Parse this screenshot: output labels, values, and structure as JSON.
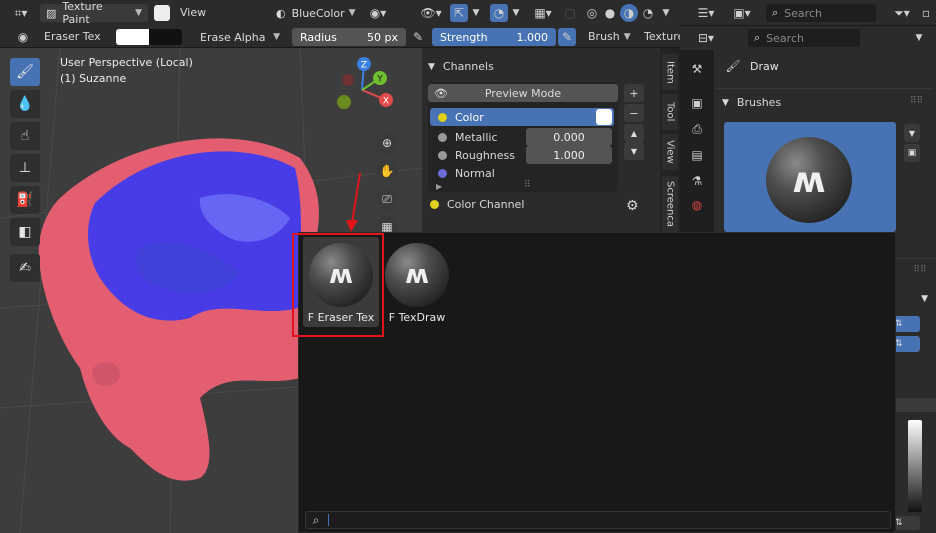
{
  "header": {
    "mode_label": "Texture Paint",
    "view_label": "View",
    "material_label": "BlueColor"
  },
  "tool_settings": {
    "brush_name": "Eraser Tex",
    "blend_mode": "Erase Alpha",
    "radius_label": "Radius",
    "radius_value": "50 px",
    "strength_label": "Strength",
    "strength_value": "1.000",
    "brush_menu": "Brush",
    "texture_menu": "Texture"
  },
  "viewport": {
    "perspective_label": "User Perspective (Local)",
    "object_label": "(1) Suzanne"
  },
  "npanel": {
    "section_title": "Channels",
    "preview_mode": "Preview Mode",
    "channels": [
      {
        "name": "Color",
        "value": "",
        "color": "#e0d21a",
        "active": true
      },
      {
        "name": "Metallic",
        "value": "0.000",
        "color": "#9a9a9a",
        "active": false
      },
      {
        "name": "Roughness",
        "value": "1.000",
        "color": "#9a9a9a",
        "active": false
      },
      {
        "name": "Normal",
        "value": "",
        "color": "#6c6cd8",
        "active": false
      }
    ],
    "color_channel_label": "Color Channel",
    "tabs": [
      "Item",
      "Tool",
      "View",
      "Screenca"
    ]
  },
  "properties": {
    "search_placeholder_top": "Search",
    "search_placeholder": "Search",
    "tool_name": "Draw",
    "brushes_title": "Brushes"
  },
  "popup": {
    "items": [
      {
        "label": "F Eraser Tex",
        "selected": true
      },
      {
        "label": "F TexDraw",
        "selected": false
      }
    ]
  },
  "colors": {
    "accent_blue": "#4772b3",
    "highlight_red": "#e0141c"
  }
}
